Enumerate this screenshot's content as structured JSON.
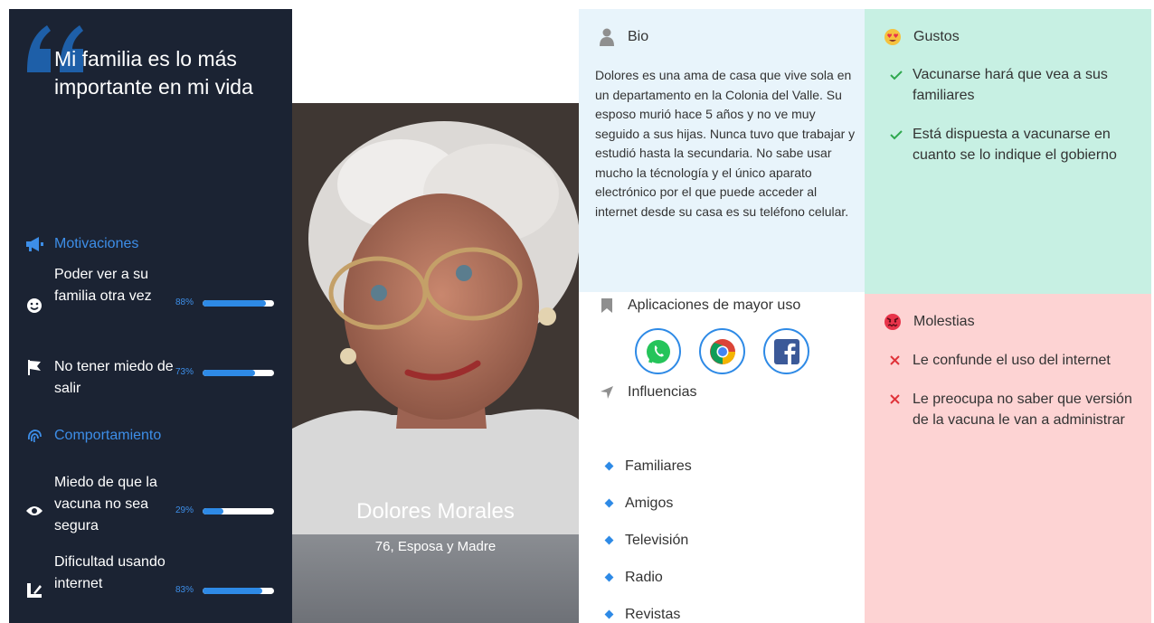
{
  "colors": {
    "accent": "#2e8ae6",
    "dark_panel": "#1b2333",
    "bio_bg": "#e8f4fb",
    "gustos_bg": "#c7f0e3",
    "molestias_bg": "#fdd3d3"
  },
  "quote": "Mi familia es lo más importante en mi vida",
  "motivations": {
    "heading": "Motivaciones",
    "icon": "megaphone-icon",
    "items": [
      {
        "label": "Poder ver a su familia otra vez",
        "percent_label": "88%",
        "percent": 88,
        "icon": "smile-icon"
      },
      {
        "label": "No tener miedo de salir",
        "percent_label": "73%",
        "percent": 73,
        "icon": "flag-icon"
      }
    ]
  },
  "behavior": {
    "heading": "Comportamiento",
    "icon": "fingerprint-icon",
    "items": [
      {
        "label": "Miedo de que la vacuna no sea segura",
        "percent_label": "29%",
        "percent": 29,
        "icon": "eye-icon"
      },
      {
        "label": "Dificultad usando internet",
        "percent_label": "83%",
        "percent": 83,
        "icon": "tools-icon"
      }
    ]
  },
  "persona": {
    "name": "Dolores Morales",
    "role": "76, Esposa y Madre"
  },
  "bio": {
    "heading": "Bio",
    "icon": "user-icon",
    "text": "Dolores es una ama de casa que vive sola en un departamento en la Colonia del Valle. Su esposo murió hace 5 años y no ve muy seguido a sus hijas. Nunca tuvo que trabajar y estudió hasta la secundaria. No sabe usar mucho la técnología y el único aparato electrónico por el que puede acceder al internet desde su casa es su teléfono celular."
  },
  "apps": {
    "heading": "Aplicaciones de mayor uso",
    "icon": "bookmark-icon",
    "items": [
      "whatsapp-icon",
      "chrome-icon",
      "facebook-icon"
    ]
  },
  "influences": {
    "heading": "Influencias",
    "icon": "location-arrow-icon",
    "items": [
      "Familiares",
      "Amigos",
      "Televisión",
      "Radio",
      "Revistas"
    ]
  },
  "likes": {
    "heading": "Gustos",
    "icon": "heart-eyes-emoji-icon",
    "items": [
      "Vacunarse hará que vea a sus familiares",
      "Está dispuesta a vacunarse en cuanto se lo indique el gobierno"
    ]
  },
  "dislikes": {
    "heading": "Molestias",
    "icon": "angry-emoji-icon",
    "items": [
      "Le confunde el uso del internet",
      "Le preocupa no saber que versión de la vacuna le van a administrar"
    ]
  }
}
